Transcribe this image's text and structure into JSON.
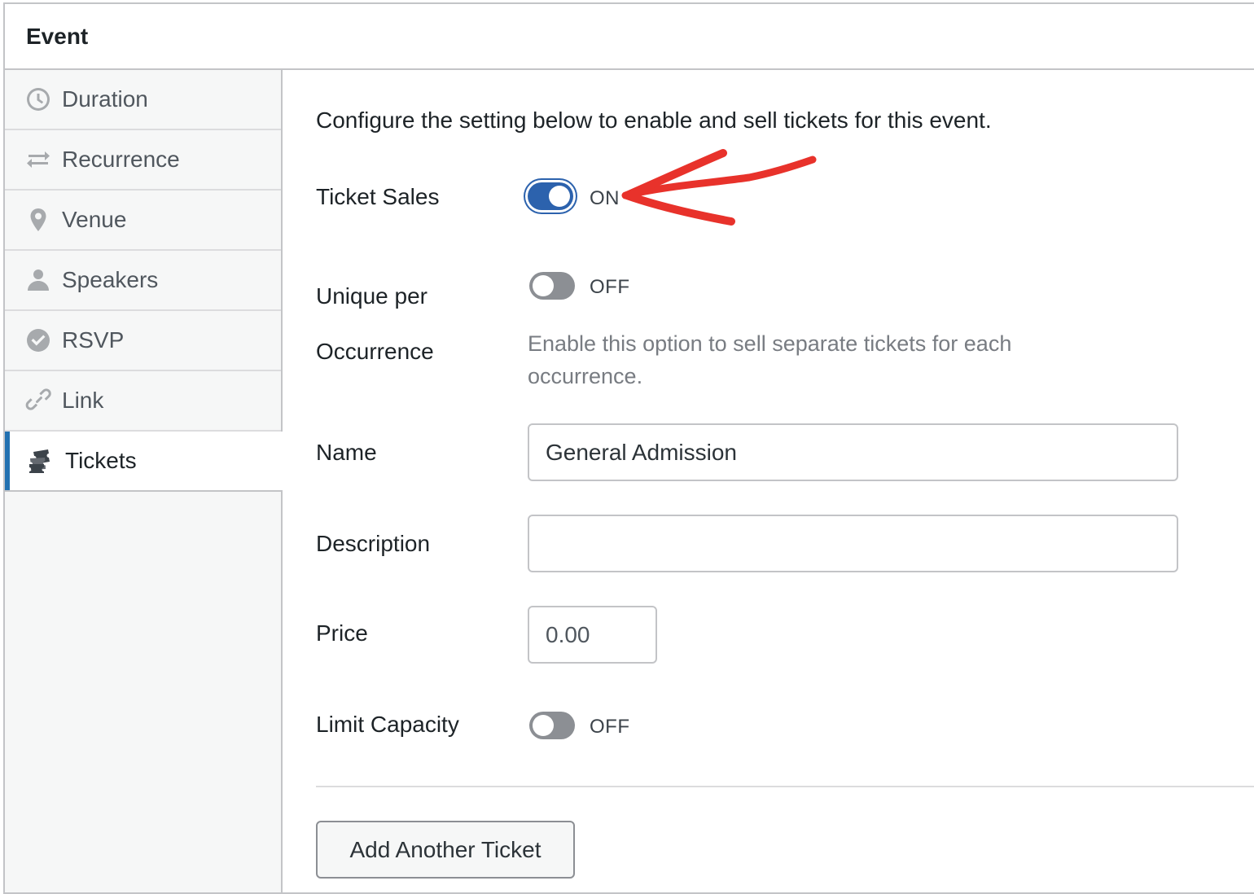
{
  "panel": {
    "title": "Event"
  },
  "sidebar": {
    "items": [
      {
        "label": "Duration",
        "icon": "clock-icon"
      },
      {
        "label": "Recurrence",
        "icon": "repeat-icon"
      },
      {
        "label": "Venue",
        "icon": "location-pin-icon"
      },
      {
        "label": "Speakers",
        "icon": "person-icon"
      },
      {
        "label": "RSVP",
        "icon": "check-circle-icon"
      },
      {
        "label": "Link",
        "icon": "link-icon"
      },
      {
        "label": "Tickets",
        "icon": "tickets-icon",
        "active": true
      }
    ]
  },
  "tickets": {
    "intro": "Configure the setting below to enable and sell tickets for this event.",
    "ticket_sales": {
      "label": "Ticket Sales",
      "state": "ON",
      "on": true
    },
    "unique_per_occurrence": {
      "label_line1": "Unique per",
      "label_line2": "Occurrence",
      "state": "OFF",
      "on": false,
      "help_line1": "Enable this option to sell separate tickets for each",
      "help_line2": "occurrence."
    },
    "name": {
      "label": "Name",
      "value": "General Admission"
    },
    "description": {
      "label": "Description",
      "value": ""
    },
    "price": {
      "label": "Price",
      "placeholder": "0.00"
    },
    "limit_capacity": {
      "label": "Limit Capacity",
      "state": "OFF",
      "on": false
    },
    "add_button": "Add Another Ticket"
  },
  "colors": {
    "accent": "#2c62ad",
    "annotation": "#e8322b",
    "toggle_off": "#8c8f94"
  }
}
